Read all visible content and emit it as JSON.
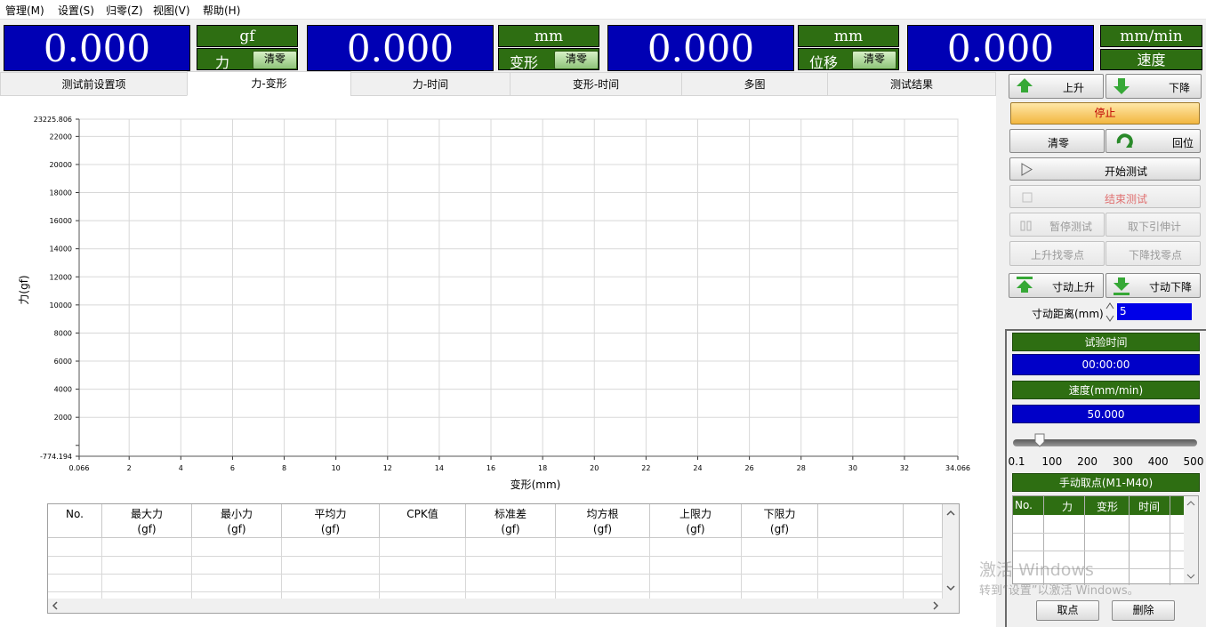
{
  "menu": [
    "管理(M)",
    "设置(S)",
    "归零(Z)",
    "视图(V)",
    "帮助(H)"
  ],
  "displays": [
    {
      "value": "0.000",
      "unit": "gf",
      "label": "力",
      "zero": "清零"
    },
    {
      "value": "0.000",
      "unit": "mm",
      "label": "变形",
      "zero": "清零"
    },
    {
      "value": "0.000",
      "unit": "mm",
      "label": "位移",
      "zero": "清零"
    },
    {
      "value": "0.000",
      "unit": "mm/min",
      "label": "速度"
    }
  ],
  "tabs": [
    "测试前设置项",
    "力-变形",
    "力-时间",
    "变形-时间",
    "多图",
    "测试结果"
  ],
  "chart_data": {
    "type": "line",
    "xlabel": "变形(mm)",
    "ylabel": "力(gf)",
    "xlim": [
      0.066,
      34.066
    ],
    "ylim": [
      -774.194,
      23225.806
    ],
    "xticks": [
      "0.066",
      "2",
      "4",
      "6",
      "8",
      "10",
      "12",
      "14",
      "16",
      "18",
      "20",
      "22",
      "24",
      "26",
      "28",
      "30",
      "32",
      "34.066"
    ],
    "yticks": [
      "23225.806",
      "22000",
      "20000",
      "18000",
      "16000",
      "14000",
      "12000",
      "10000",
      "8000",
      "6000",
      "4000",
      "2000",
      "-774.194"
    ],
    "grid": true,
    "series": []
  },
  "table": {
    "headers": [
      [
        "No.",
        ""
      ],
      [
        "最大力",
        "(gf)"
      ],
      [
        "最小力",
        "(gf)"
      ],
      [
        "平均力",
        "(gf)"
      ],
      [
        "CPK值",
        ""
      ],
      [
        "标准差",
        "(gf)"
      ],
      [
        "均方根",
        "(gf)"
      ],
      [
        "上限力",
        "(gf)"
      ],
      [
        "下限力",
        "(gf)"
      ],
      [
        "",
        ""
      ],
      [
        "",
        ""
      ]
    ]
  },
  "controls": {
    "up": "上升",
    "down": "下降",
    "stop": "停止",
    "zero": "清零",
    "home": "回位",
    "start": "开始测试",
    "end": "结束测试",
    "pause": "暂停测试",
    "remove_ext": "取下引伸计",
    "up_find_zero": "上升找零点",
    "down_find_zero": "下降找零点",
    "jog_up": "寸动上升",
    "jog_down": "寸动下降",
    "jog_dist_label": "寸动距离(mm)",
    "jog_dist_value": "5"
  },
  "test_panel": {
    "time_label": "试验时间",
    "time_value": "00:00:00",
    "speed_label": "速度(mm/min)",
    "speed_value": "50.000",
    "slider_level": 0.05,
    "slider_ticks": [
      "0.1",
      "100",
      "200",
      "300",
      "400",
      "500"
    ],
    "manual_points_label": "手动取点(M1-M40)",
    "points_headers": [
      "No.",
      "力",
      "变形",
      "时间"
    ],
    "take_point": "取点",
    "delete": "删除"
  },
  "watermark": {
    "line1": "激活 Windows",
    "line2": "转到“设置”以激活 Windows。"
  }
}
